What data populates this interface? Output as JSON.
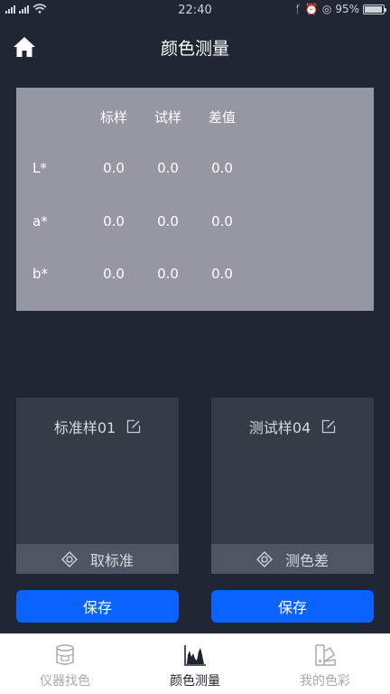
{
  "status_bar": {
    "time": "22:40",
    "battery": "95%",
    "battery_level": 0.95
  },
  "header": {
    "title": "颜色测量"
  },
  "results": {
    "columns": [
      "标样",
      "试样",
      "差值"
    ],
    "rows": [
      {
        "label": "L*",
        "values": [
          "0.0",
          "0.0",
          "0.0"
        ]
      },
      {
        "label": "a*",
        "values": [
          "0.0",
          "0.0",
          "0.0"
        ]
      },
      {
        "label": "b*",
        "values": [
          "0.0",
          "0.0",
          "0.0"
        ]
      }
    ]
  },
  "standard_card": {
    "name": "标准样01",
    "action": "取标准",
    "save": "保存"
  },
  "trial_card": {
    "name": "测试样04",
    "action": "测色差",
    "save": "保存"
  },
  "tabs": [
    {
      "label": "仪器找色",
      "icon": "instrument-icon",
      "active": false
    },
    {
      "label": "颜色测量",
      "icon": "spectrum-icon",
      "active": true
    },
    {
      "label": "我的色彩",
      "icon": "color-fan-icon",
      "active": false
    }
  ],
  "colors": {
    "background": "#202633",
    "panel": "#9598a3",
    "card": "#353b47",
    "accent": "#0a62ff"
  }
}
